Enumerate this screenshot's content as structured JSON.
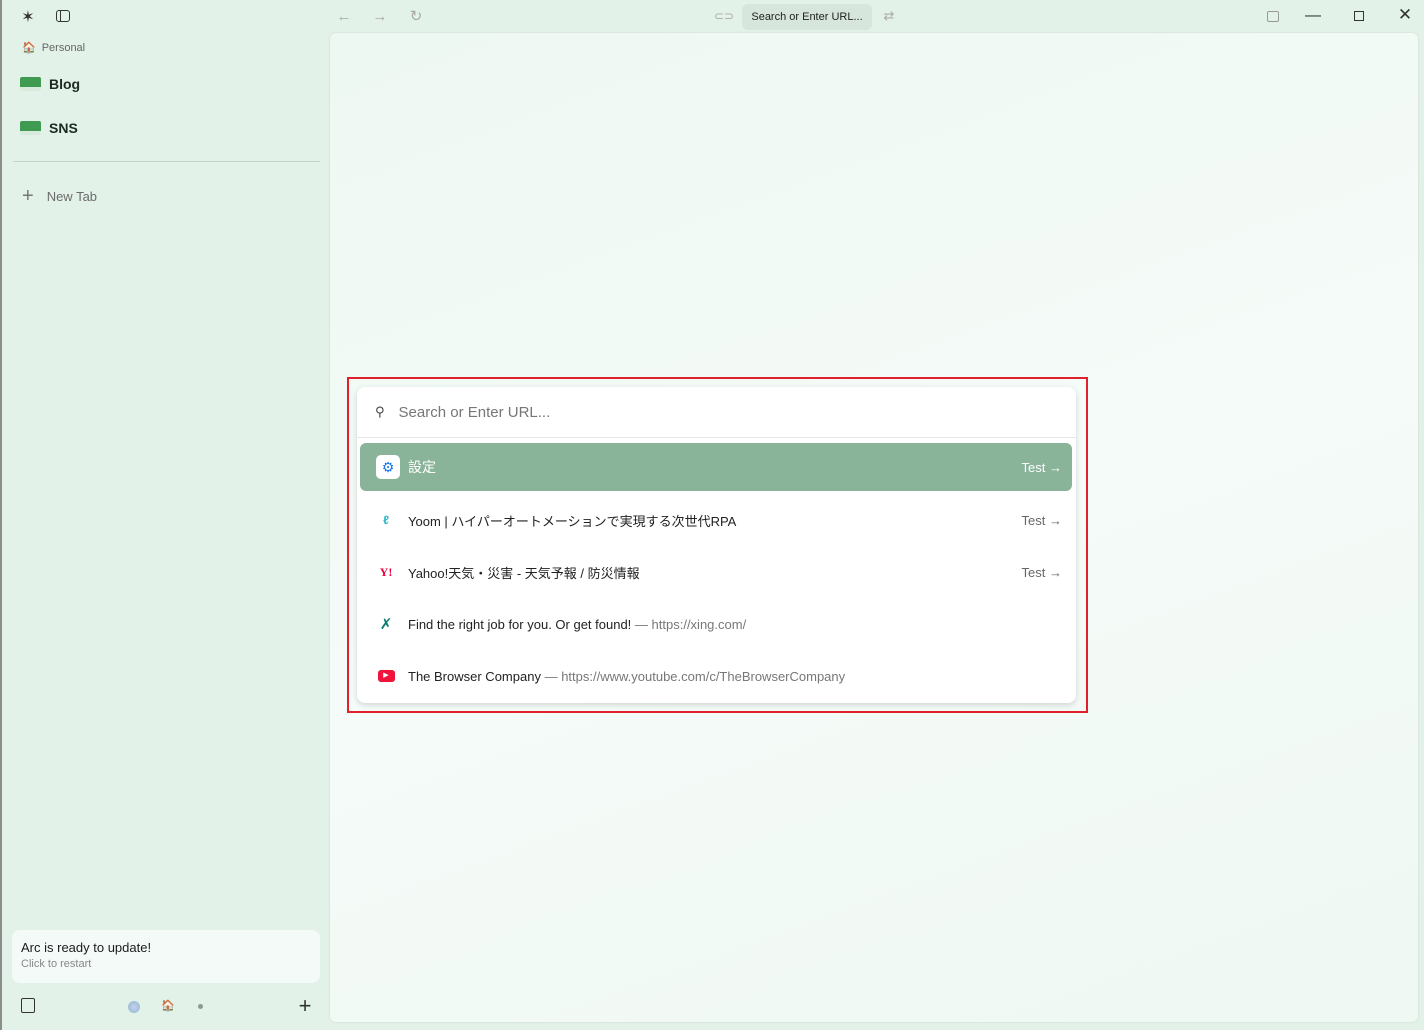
{
  "sidebar": {
    "space": "Personal",
    "folders": [
      {
        "label": "Blog"
      },
      {
        "label": "SNS"
      }
    ],
    "new_tab": "New Tab",
    "update": {
      "title": "Arc is ready to update!",
      "subtitle": "Click to restart"
    }
  },
  "toolbar": {
    "url_pill": "Search or Enter URL..."
  },
  "palette": {
    "placeholder": "Search or Enter URL...",
    "results": [
      {
        "title": "設定",
        "url": "",
        "action": "Test",
        "icon": "gear-icon",
        "selected": true
      },
      {
        "title": "Yoom | ハイパーオートメーションで実現する次世代RPA",
        "url": "",
        "action": "Test",
        "icon": "yoom-icon"
      },
      {
        "title": "Yahoo!天気・災害 - 天気予報 / 防災情報",
        "url": "",
        "action": "Test",
        "icon": "yahoo-icon"
      },
      {
        "title": "Find the right job for you. Or get found!",
        "url": "— https://xing.com/",
        "action": "",
        "icon": "xing-icon"
      },
      {
        "title": "The Browser Company",
        "url": "— https://www.youtube.com/c/TheBrowserCompany",
        "action": "",
        "icon": "youtube-icon"
      }
    ]
  },
  "colors": {
    "selected": "#8ab49a",
    "annotation": "#e0202a",
    "background": "#e3f2e9"
  }
}
